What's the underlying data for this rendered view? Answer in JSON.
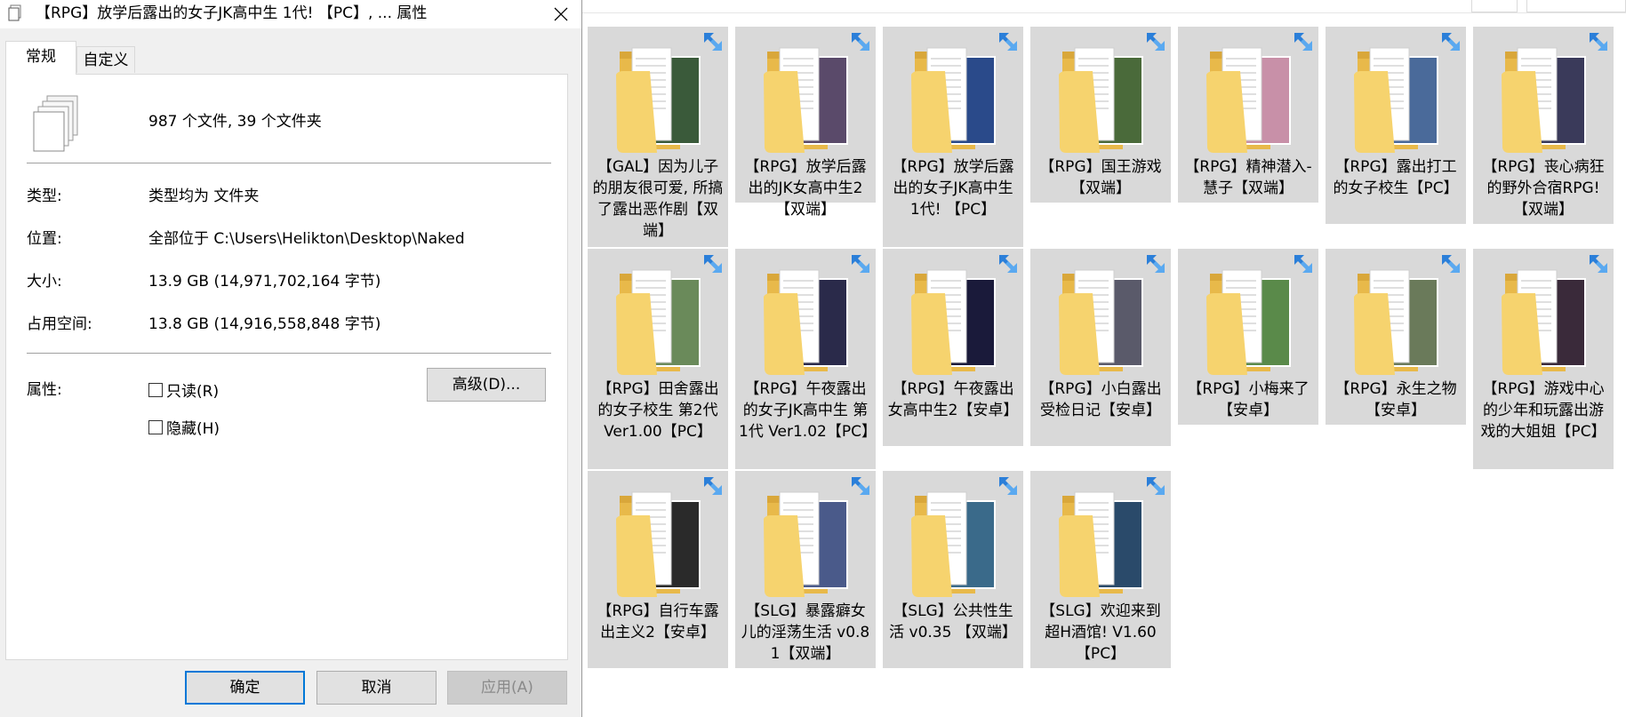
{
  "dialog": {
    "title": "【RPG】放学后露出的女子JK高中生 1代! 【PC】, ... 属性",
    "tabs": {
      "general": "常规",
      "custom": "自定义"
    },
    "summary": "987 个文件, 39 个文件夹",
    "rows": {
      "type_label": "类型:",
      "type_value": "类型均为 文件夹",
      "location_label": "位置:",
      "location_value": "全部位于 C:\\Users\\Helikton\\Desktop\\Naked",
      "size_label": "大小:",
      "size_value": "13.9 GB (14,971,702,164 字节)",
      "disk_label": "占用空间:",
      "disk_value": "13.8 GB (14,916,558,848 字节)",
      "attr_label": "属性:"
    },
    "attributes": {
      "readonly": "只读(R)",
      "hidden": "隐藏(H)",
      "advanced": "高级(D)..."
    },
    "buttons": {
      "ok": "确定",
      "cancel": "取消",
      "apply": "应用(A)"
    }
  },
  "explorer": {
    "folders": [
      {
        "label": "【GAL】因为儿子的朋友很可爱, 所搞了露出恶作剧【双端】",
        "thumb": "#3a5a3a"
      },
      {
        "label": "【RPG】放学后露出的JK女高中生2 【双端】",
        "thumb": "#5a4a6a"
      },
      {
        "label": "【RPG】放学后露出的女子JK高中生 1代! 【PC】",
        "thumb": "#2a4a8a"
      },
      {
        "label": "【RPG】国王游戏【双端】",
        "thumb": "#4a6a3a"
      },
      {
        "label": "【RPG】精神潜入-慧子【双端】",
        "thumb": "#c890a8"
      },
      {
        "label": "【RPG】露出打工的女子校生【PC】",
        "thumb": "#4a6a9a"
      },
      {
        "label": "【RPG】丧心病狂的野外合宿RPG! 【双端】",
        "thumb": "#3a3a5a"
      },
      {
        "label": "【RPG】田舍露出的女子校生 第2代 Ver1.00【PC】",
        "thumb": "#6a8a5a"
      },
      {
        "label": "【RPG】午夜露出的女子JK高中生 第1代 Ver1.02【PC】",
        "thumb": "#2a2a4a"
      },
      {
        "label": "【RPG】午夜露出女高中生2【安卓】",
        "thumb": "#1a1a3a"
      },
      {
        "label": "【RPG】小白露出受检日记【安卓】",
        "thumb": "#5a5a6a"
      },
      {
        "label": "【RPG】小梅来了【安卓】",
        "thumb": "#5a8a4a"
      },
      {
        "label": "【RPG】永生之物【安卓】",
        "thumb": "#6a7a5a"
      },
      {
        "label": "【RPG】游戏中心的少年和玩露出游戏的大姐姐【PC】",
        "thumb": "#3a2a3a"
      },
      {
        "label": "【RPG】自行车露出主义2【安卓】",
        "thumb": "#2a2a2a"
      },
      {
        "label": "【SLG】暴露癖女儿的淫荡生活 v0.81【双端】",
        "thumb": "#4a5a8a"
      },
      {
        "label": "【SLG】公共性生活 v0.35 【双端】",
        "thumb": "#3a6a8a"
      },
      {
        "label": "【SLG】欢迎来到超H酒馆! V1.60【PC】",
        "thumb": "#2a4a6a"
      }
    ]
  }
}
